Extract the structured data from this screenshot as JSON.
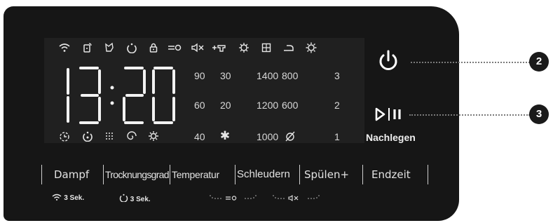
{
  "display": {
    "time_hours": "13",
    "time_minutes": "20",
    "status_icons": [
      "wifi-icon",
      "remote-start-icon",
      "no-crease-icon",
      "delay-start-icon",
      "child-lock-icon",
      "key-icon",
      "mute-icon",
      "extra-rinse-icon",
      "stain-icon",
      "grid-icon",
      "iron-icon",
      "settings-icon"
    ],
    "bottom_icons": [
      "timer-icon",
      "end-time-icon",
      "dots-icon",
      "spiral-icon",
      "gear-small-icon"
    ],
    "temperature_values": [
      "90",
      "60",
      "40"
    ],
    "second_values": [
      "30",
      "20"
    ],
    "cold_icon": "snowflake-icon",
    "spin_values_left": [
      "1400",
      "1200",
      "1000"
    ],
    "spin_values_right": [
      "800",
      "600"
    ],
    "no_spin_icon": "no-spin-icon",
    "level_values": [
      "3",
      "2",
      "1"
    ]
  },
  "buttons": {
    "dampf": "Dampf",
    "trocknungsgrad": "Trocknungsgrad",
    "temperatur": "Temperatur",
    "schleudern": "Schleudern",
    "spuelen": "Spülen+",
    "endzeit": "Endzeit"
  },
  "hints": {
    "wifi_hold": "3 Sek.",
    "delay_hold": "3 Sek."
  },
  "controls": {
    "start_pause_label": "Nachlegen"
  },
  "callouts": {
    "power": "2",
    "start": "3"
  }
}
